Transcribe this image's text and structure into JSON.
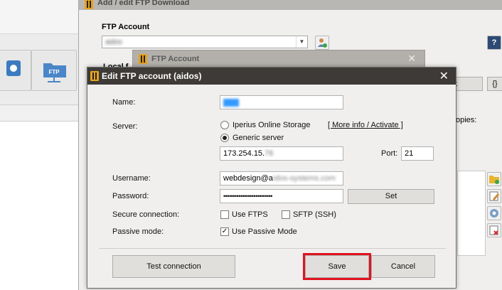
{
  "background_window": {
    "title": "Add / edit FTP Download",
    "ftp_account_label": "FTP Account",
    "ftp_account_value": "aidos",
    "partial_label_1": "Local f",
    "partial_text_copies": "opies:",
    "partial_button_t": "t",
    "braces_button": "{}",
    "help_button": "?"
  },
  "ftp_account_window": {
    "title": "FTP Account",
    "close": "✕"
  },
  "dialog": {
    "title": "Edit FTP account (aidos)",
    "close": "✕",
    "name_label": "Name:",
    "server_label": "Server:",
    "server_options": [
      {
        "label": "Iperius Online Storage",
        "selected": false
      },
      {
        "label": "Generic server",
        "selected": true
      }
    ],
    "more_info_link": "[ More info / Activate ]",
    "server_address": "173.254.15.",
    "server_address_blur": "76",
    "port_label": "Port:",
    "port_value": "21",
    "username_label": "Username:",
    "username_value": "webdesign@a",
    "username_blur": "idos-systems.com",
    "password_label": "Password:",
    "password_value": "••••••••••••••••••••••••••",
    "set_button": "Set",
    "secure_label": "Secure connection:",
    "use_ftps": {
      "label": "Use FTPS",
      "checked": false
    },
    "sftp": {
      "label": "SFTP (SSH)",
      "checked": false
    },
    "passive_label": "Passive mode:",
    "use_passive": {
      "label": "Use Passive Mode",
      "checked": true
    },
    "test_button": "Test connection",
    "save_button": "Save",
    "cancel_button": "Cancel"
  },
  "colors": {
    "dialog_title_bg": "#3d3a37",
    "highlight_red": "#e0141e",
    "app_icon": "#e6a11c"
  }
}
